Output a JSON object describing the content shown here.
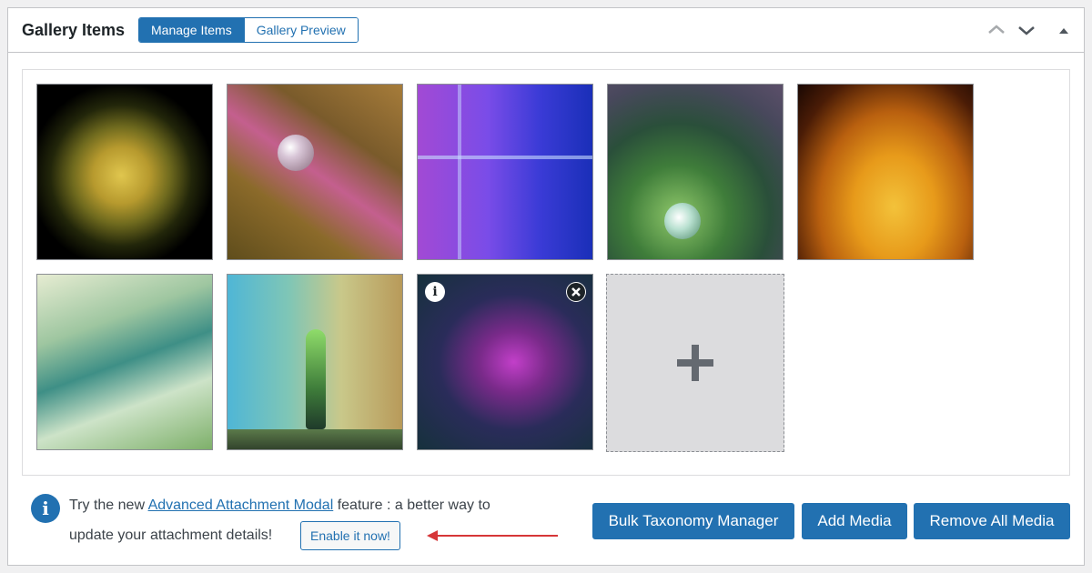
{
  "header": {
    "title": "Gallery Items",
    "tabs": [
      {
        "label": "Manage Items",
        "active": true
      },
      {
        "label": "Gallery Preview",
        "active": false
      }
    ],
    "controls": [
      "chevron-up-icon",
      "chevron-down-icon",
      "triangle-up-icon"
    ]
  },
  "gallery": {
    "items": [
      {
        "name": "yellow-rose-with-dew"
      },
      {
        "name": "pink-stem-water-droplet"
      },
      {
        "name": "purple-blue-water-splash"
      },
      {
        "name": "green-bubble-flower"
      },
      {
        "name": "orange-petal-droplets"
      },
      {
        "name": "green-blue-grass-macro"
      },
      {
        "name": "water-drop-splash"
      },
      {
        "name": "purple-petal-droplet"
      }
    ],
    "hovered_item_icons": [
      "info-icon",
      "close-icon"
    ],
    "add_tile_icon": "plus-icon"
  },
  "notice": {
    "text_before": "Try the new ",
    "link": "Advanced Attachment Modal",
    "text_after": " feature : a better way to",
    "line2": "update your attachment details!",
    "enable_button": "Enable it now!",
    "icon": "info-icon"
  },
  "actions": {
    "bulk_taxonomy": "Bulk Taxonomy Manager",
    "add_media": "Add Media",
    "remove_all": "Remove All Media"
  },
  "colors": {
    "accent": "#2271b1",
    "arrow": "#d63638",
    "border": "#c3c4c7"
  }
}
